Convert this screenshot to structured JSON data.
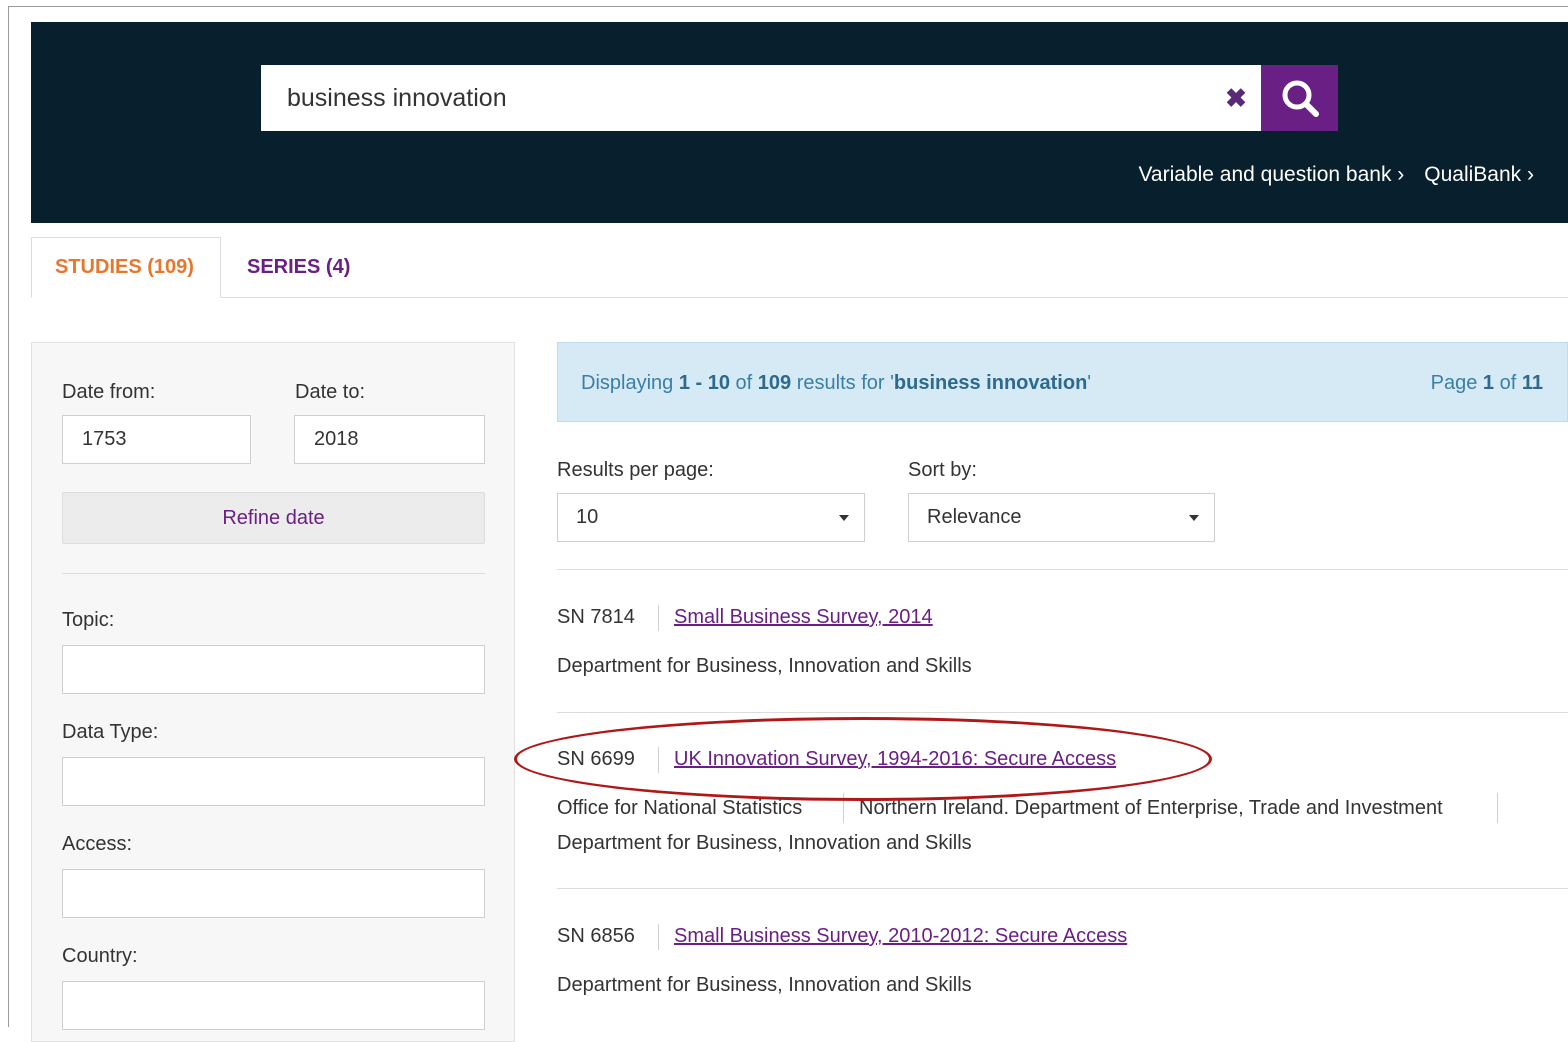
{
  "search": {
    "query": "business innovation",
    "clear_label": "✖"
  },
  "header_links": [
    {
      "label": "Variable and question bank ›"
    },
    {
      "label": "QualiBank ›"
    }
  ],
  "tabs": [
    {
      "label": "STUDIES (109)",
      "active": true
    },
    {
      "label": "SERIES (4)",
      "active": false
    }
  ],
  "filters": {
    "date_from_label": "Date from:",
    "date_from_value": "1753",
    "date_to_label": "Date to:",
    "date_to_value": "2018",
    "refine_label": "Refine date",
    "topic_label": "Topic:",
    "data_type_label": "Data Type:",
    "access_label": "Access:",
    "country_label": "Country:"
  },
  "results_info": {
    "displaying": "Displaying",
    "range": "1 - 10",
    "of": "of",
    "total": "109",
    "results_for": "results for '",
    "query": "business innovation",
    "quote_end": "'",
    "page_word": "Page",
    "page_current": "1",
    "page_of": "of",
    "page_total": "11"
  },
  "controls": {
    "per_page_label": "Results per page:",
    "per_page_value": "10",
    "sort_label": "Sort by:",
    "sort_value": "Relevance"
  },
  "results": [
    {
      "sn": "SN 7814",
      "title": "Small Business Survey, 2014",
      "depositors": [
        "Department for Business, Innovation and Skills"
      ]
    },
    {
      "sn": "SN 6699",
      "title": "UK Innovation Survey, 1994-2016: Secure Access",
      "depositors": [
        "Office for National Statistics",
        "Northern Ireland. Department of Enterprise, Trade and Investment",
        "Department for Business, Innovation and Skills"
      ],
      "highlighted": true
    },
    {
      "sn": "SN 6856",
      "title": "Small Business Survey, 2010-2012: Secure Access",
      "depositors": [
        "Department for Business, Innovation and Skills"
      ]
    }
  ],
  "colors": {
    "header_bg": "#08202e",
    "brand_purple": "#6a1f85",
    "active_tab": "#e8762c",
    "info_bg": "#d5eaf5",
    "annotation_red": "#b01818"
  }
}
